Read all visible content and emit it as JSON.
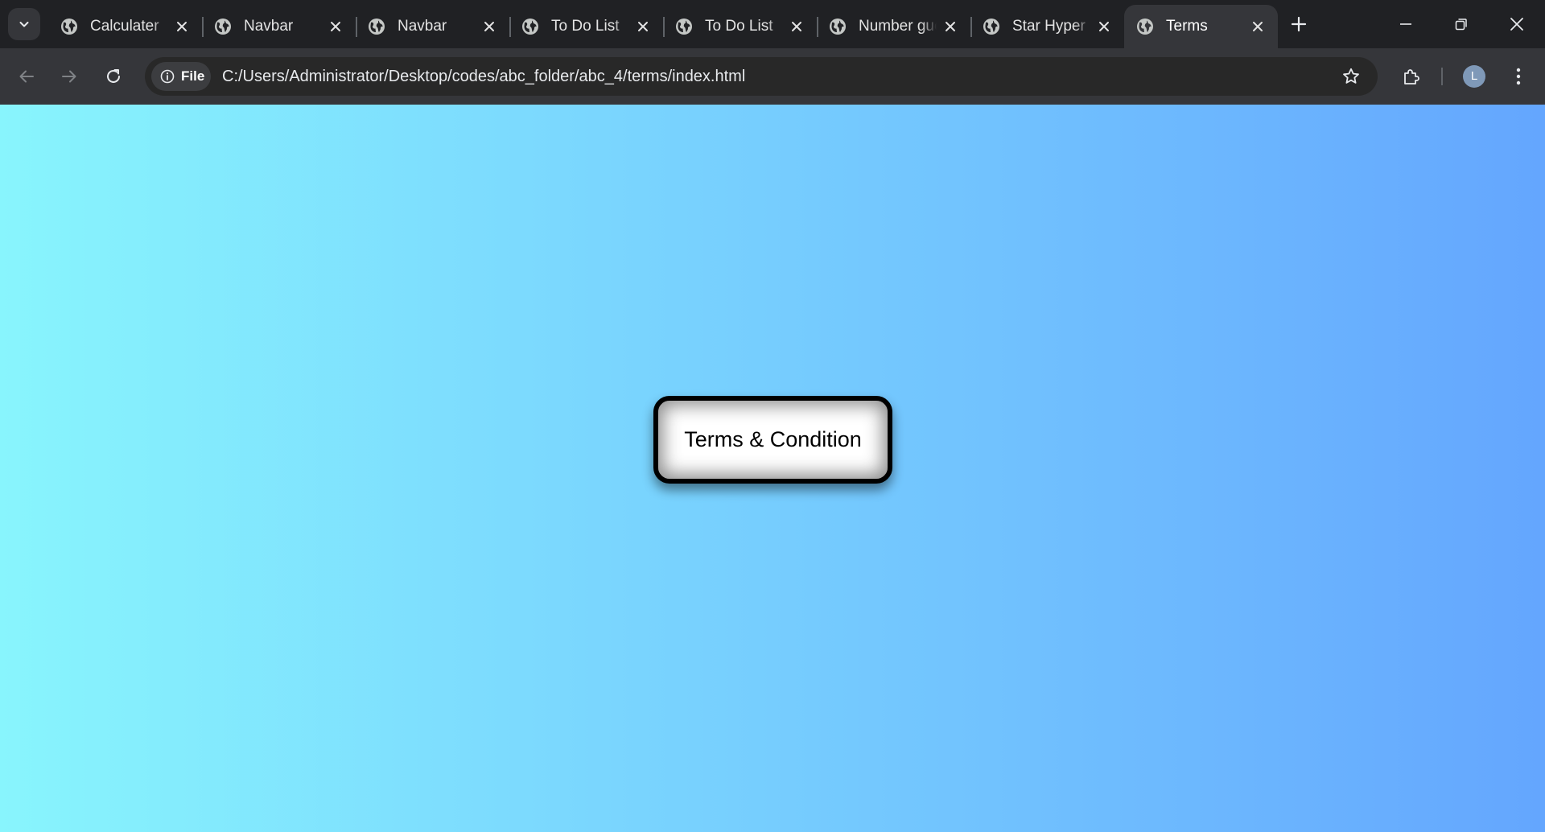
{
  "browser": {
    "tabs": [
      {
        "title": "Calculater",
        "active": false,
        "icon": "globe-icon"
      },
      {
        "title": "Navbar",
        "active": false,
        "icon": "globe-icon"
      },
      {
        "title": "Navbar",
        "active": false,
        "icon": "globe-icon"
      },
      {
        "title": "To Do List",
        "active": false,
        "icon": "globe-icon"
      },
      {
        "title": "To Do List",
        "active": false,
        "icon": "globe-icon"
      },
      {
        "title": "Number guessing",
        "active": false,
        "icon": "globe-icon"
      },
      {
        "title": "Star Hyper",
        "active": false,
        "icon": "globe-icon"
      },
      {
        "title": "Terms",
        "active": true,
        "icon": "globe-icon"
      }
    ],
    "address_bar": {
      "chip_label": "File",
      "url": "C:/Users/Administrator/Desktop/codes/abc_folder/abc_4/terms/index.html"
    },
    "profile_initial": "L",
    "colors": {
      "frame": "#202124",
      "toolbar": "#35363a",
      "omnibox": "#282828"
    }
  },
  "page": {
    "button_label": "Terms & Condition",
    "background_gradient": [
      "#88f5fd",
      "#76cdfe",
      "#64a6fe"
    ]
  }
}
